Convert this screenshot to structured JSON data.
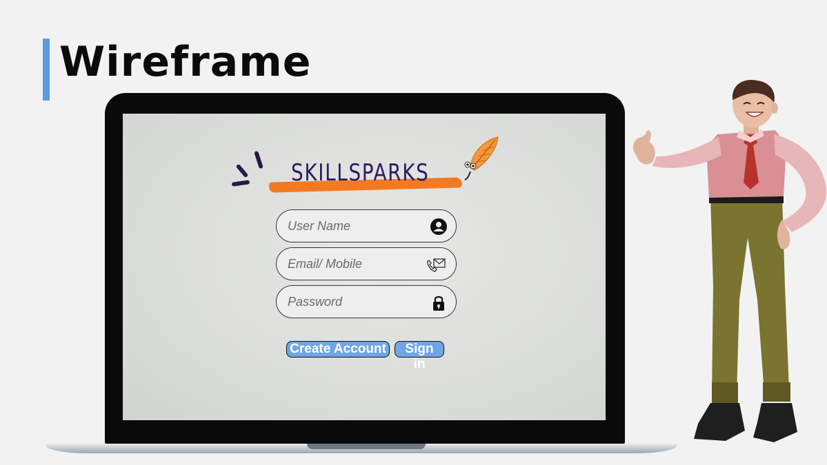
{
  "slide": {
    "title": "Wireframe"
  },
  "app": {
    "logo_text": "SKILLSPARKS"
  },
  "form": {
    "username": {
      "placeholder": "User Name",
      "value": "",
      "icon": "user-circle-icon"
    },
    "email": {
      "placeholder": "Email/ Mobile",
      "value": "",
      "icon": "phone-mail-icon"
    },
    "password": {
      "placeholder": "Password",
      "value": "",
      "icon": "lock-icon"
    }
  },
  "buttons": {
    "create_account": "Create Account",
    "sign_in": "Sign in"
  },
  "colors": {
    "accent_bar": "#5b9be0",
    "brush": "#f37a21",
    "logo_text": "#2d1b5e",
    "button_fill": "#6ea6e6"
  }
}
